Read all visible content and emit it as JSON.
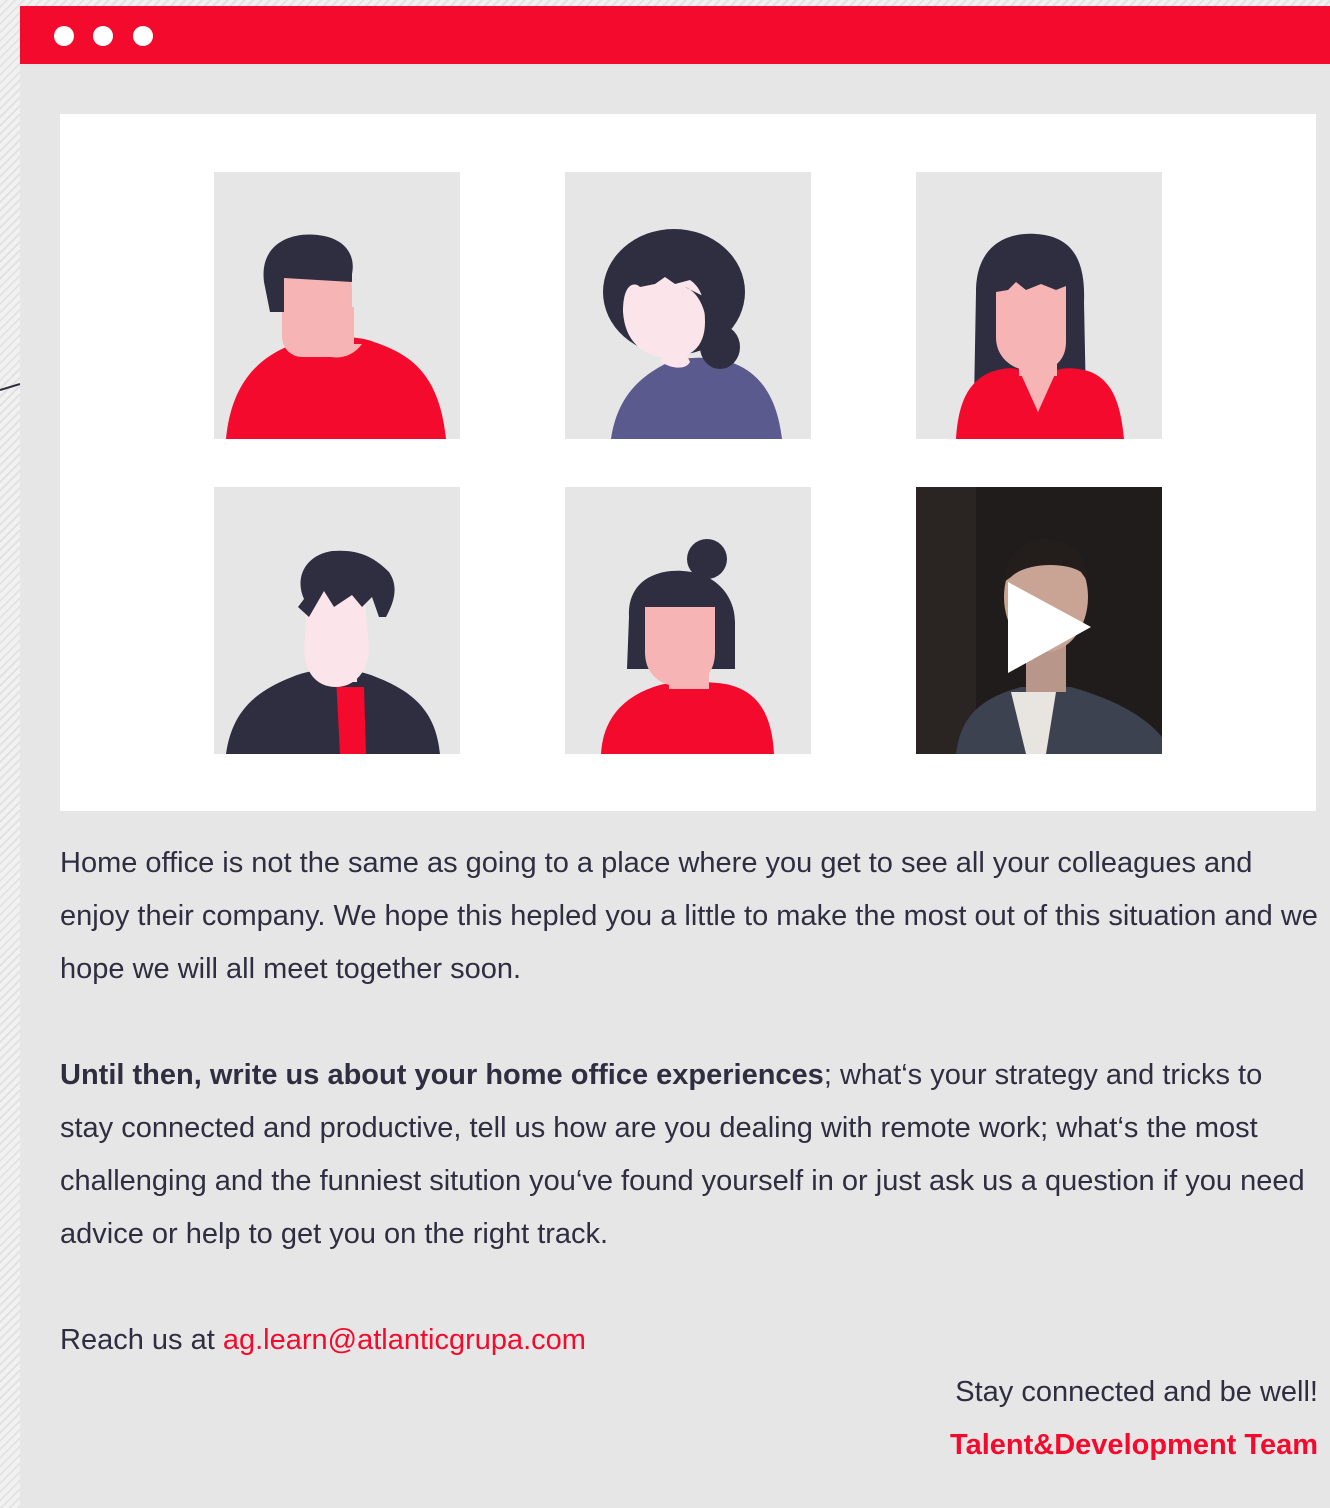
{
  "window": {
    "title_dots": 3,
    "accent_color": "#f40a2c",
    "panel_color": "#ffffff",
    "text_color": "#2f2e41"
  },
  "avatars": [
    {
      "icon": "man-avatar-icon",
      "shirt": "#f40a2c"
    },
    {
      "icon": "woman-ponytail-avatar-icon",
      "shirt": "#5a5a8e"
    },
    {
      "icon": "woman-long-hair-avatar-icon",
      "shirt": "#f40a2c"
    },
    {
      "icon": "man-jacket-avatar-icon",
      "shirt": "#2f2e41"
    },
    {
      "icon": "woman-bun-avatar-icon",
      "shirt": "#f40a2c"
    },
    {
      "icon": "video-thumbnail-play-icon"
    }
  ],
  "message": {
    "paragraph1": "Home office is not the same as going to a place where you get to see all your colleagues and enjoy their company. We hope this hepled you a little to make the most out of this situation and we hope we will all meet together soon.",
    "paragraph2_bold": "Until then, write us about your home office experiences",
    "paragraph2_rest": "; what‘s your strategy and tricks to stay connected and productive, tell us how are you dealing with remote work; what‘s the most challenging and the funniest sitution you‘ve found yourself in or just ask us a question if you need advice or help to get you on the right track.",
    "reach_prefix": "Reach us at ",
    "email": "ag.learn@atlanticgrupa.com"
  },
  "signature": {
    "closing": "Stay connected and be well!",
    "team": "Talent&Development Team"
  }
}
